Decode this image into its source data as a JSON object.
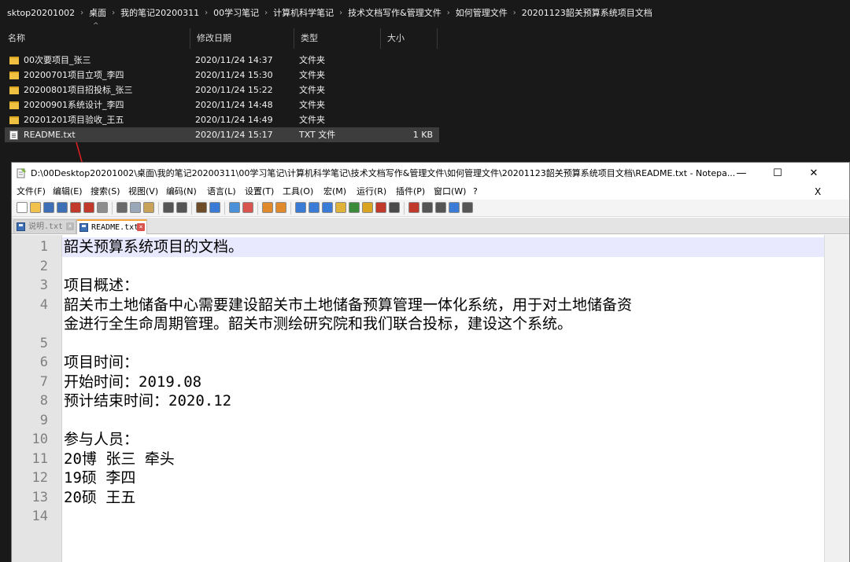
{
  "explorer": {
    "breadcrumb": [
      "sktop20201002",
      "桌面",
      "我的笔记20200311",
      "00学习笔记",
      "计算机科学笔记",
      "技术文档写作&管理文件",
      "如何管理文件",
      "20201123韶关预算系统项目文档"
    ],
    "columns": {
      "name": "名称",
      "date": "修改日期",
      "type": "类型",
      "size": "大小"
    },
    "files": [
      {
        "name": "00次要项目_张三",
        "date": "2020/11/24 14:37",
        "type": "文件夹",
        "size": "",
        "icon": "folder-icon"
      },
      {
        "name": "20200701项目立项_李四",
        "date": "2020/11/24 15:30",
        "type": "文件夹",
        "size": "",
        "icon": "folder-icon"
      },
      {
        "name": "20200801项目招投标_张三",
        "date": "2020/11/24 15:22",
        "type": "文件夹",
        "size": "",
        "icon": "folder-icon"
      },
      {
        "name": "20200901系统设计_李四",
        "date": "2020/11/24 14:48",
        "type": "文件夹",
        "size": "",
        "icon": "folder-icon"
      },
      {
        "name": "20201201项目验收_王五",
        "date": "2020/11/24 14:49",
        "type": "文件夹",
        "size": "",
        "icon": "folder-icon"
      },
      {
        "name": "README.txt",
        "date": "2020/11/24 15:17",
        "type": "TXT 文件",
        "size": "1 KB",
        "icon": "txt-file-icon",
        "selected": true
      }
    ]
  },
  "notepad": {
    "title": "D:\\00Desktop20201002\\桌面\\我的笔记20200311\\00学习笔记\\计算机科学笔记\\技术文档写作&管理文件\\如何管理文件\\20201123韶关预算系统项目文档\\README.txt - Notepa...",
    "window_buttons": {
      "minimize": "—",
      "maximize": "☐",
      "close": "✕"
    },
    "menu": [
      "文件(F)",
      "编辑(E)",
      "搜索(S)",
      "视图(V)",
      "编码(N)",
      "语言(L)",
      "设置(T)",
      "工具(O)",
      "宏(M)",
      "运行(R)",
      "插件(P)",
      "窗口(W)",
      "?"
    ],
    "menu_close": "X",
    "tabs": [
      {
        "label": "说明.txt",
        "active": false
      },
      {
        "label": "README.txt",
        "active": true
      }
    ],
    "lines": [
      {
        "n": "1",
        "text": "韶关预算系统项目的文档。"
      },
      {
        "n": "2",
        "text": ""
      },
      {
        "n": "3",
        "text": "项目概述："
      },
      {
        "n": "4",
        "text": "韶关市土地储备中心需要建设韶关市土地储备预算管理一体化系统，用于对土地储备资"
      },
      {
        "n": "",
        "text": "金进行全生命周期管理。韶关市测绘研究院和我们联合投标，建设这个系统。"
      },
      {
        "n": "5",
        "text": ""
      },
      {
        "n": "6",
        "text": "项目时间："
      },
      {
        "n": "7",
        "text": "开始时间：2019.08"
      },
      {
        "n": "8",
        "text": "预计结束时间：2020.12"
      },
      {
        "n": "9",
        "text": ""
      },
      {
        "n": "10",
        "text": "参与人员："
      },
      {
        "n": "11",
        "text": "20博 张三 牵头"
      },
      {
        "n": "12",
        "text": "19硕 李四"
      },
      {
        "n": "13",
        "text": "20硕 王五"
      },
      {
        "n": "14",
        "text": ""
      }
    ],
    "current_line": 1
  },
  "colors": {
    "explorer_bg": "#191919",
    "selection_bg": "#3d3d3d",
    "current_line_bg": "#e8e8ff",
    "gutter_bg": "#e4e4e4",
    "annotation_arrow": "#e02020",
    "active_tab_accent": "#f4a23a"
  }
}
